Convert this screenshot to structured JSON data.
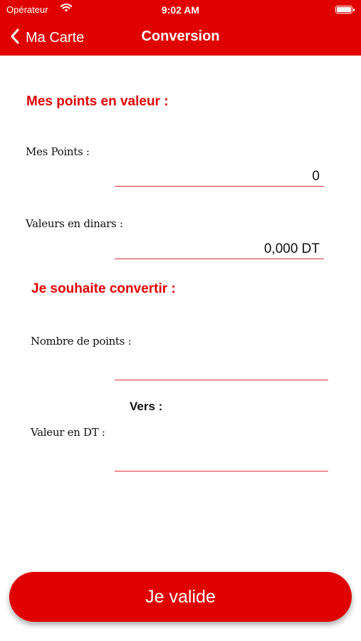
{
  "status_bar": {
    "carrier": "Opérateur",
    "time": "9:02 AM"
  },
  "nav": {
    "back_label": "Ma Carte",
    "title": "Conversion"
  },
  "points_section": {
    "title": "Mes points en valeur :",
    "points_label": "Mes Points :",
    "points_value": "0",
    "dinars_label": "Valeurs en dinars :",
    "dinars_value": "0,000 DT"
  },
  "convert_section": {
    "title": "Je souhaite convertir :",
    "points_count_label": "Nombre de points :",
    "points_count_value": "",
    "vers_label": "Vers :",
    "dt_value_label": "Valeur en DT :",
    "dt_value_value": ""
  },
  "validate_button": "Je valide",
  "colors": {
    "accent": "#e00000",
    "underline": "#e03030"
  },
  "icons": {
    "back": "chevron-left-icon",
    "wifi": "wifi-icon",
    "battery": "battery-icon"
  }
}
